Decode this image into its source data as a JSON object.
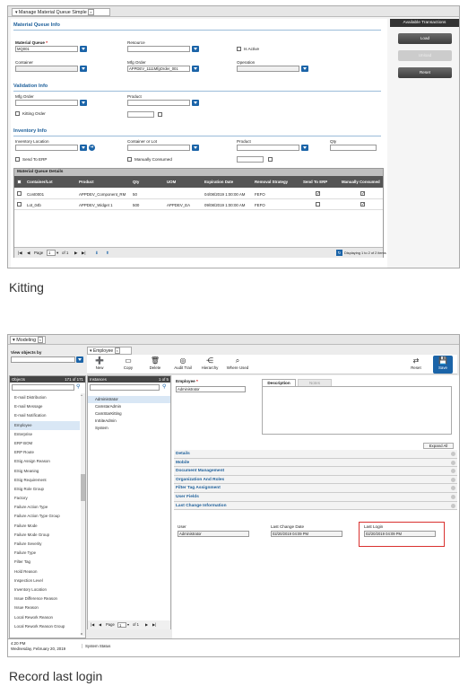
{
  "kitting": {
    "tab_title": "Manage Material Queue Simple",
    "sections": {
      "material_queue": "Material Queue Info",
      "validation": "Validation Info",
      "inventory": "Inventory Info"
    },
    "fields": {
      "material_queue_label": "Material Queue",
      "material_queue_value": "MQ001",
      "resource_label": "Resource",
      "is_active_label": "Is Active",
      "container_label": "Container",
      "mfg_order_label": "Mfg Order",
      "mfg_order_value": "APPDEV_1111MfgOrder_001",
      "operation_label": "Operation",
      "vmfg_order_label": "Mfg Order",
      "product_label": "Product",
      "kitting_order_label": "Kitting Order",
      "inventory_location_label": "Inventory Location",
      "container_or_lot_label": "Container or Lot",
      "inv_product_label": "Product",
      "qty_label": "Qty",
      "send_to_erp_label": "Send To ERP",
      "manually_consumed_label": "Manually Consumed"
    },
    "grid": {
      "title": "Material Queue Details",
      "columns": [
        "Container/Lot",
        "Product",
        "Qty",
        "UOM",
        "Expiration Date",
        "Removal Strategy",
        "Send To ERP",
        "Manually Consumed"
      ],
      "rows": [
        {
          "lot": "Cont0001",
          "product": "APPDEV_Component_RM",
          "qty": "50",
          "uom": "",
          "exp": "04/08/2019 1:00:00 AM",
          "strategy": "FEFO",
          "erp": false,
          "manual": true
        },
        {
          "lot": "Lot_04b",
          "product": "APPDEV_Widget 1",
          "qty": "500",
          "uom": "APPDEV_EA",
          "exp": "09/08/2019 1:00:00 AM",
          "strategy": "FEFO",
          "erp": false,
          "manual": true
        }
      ],
      "page_label": "Page",
      "page_value": "1",
      "of_label": "of 1",
      "displaying": "Displaying 1 to 2 of 2 items"
    },
    "transactions": {
      "title": "Available Transactions",
      "load": "Load",
      "unload": "Unload",
      "reset": "Reset"
    }
  },
  "caption1": "Kitting",
  "modeling": {
    "tab_title": "Modeling",
    "view_objects_by": "View objects by",
    "employee_tab": "Employee",
    "toolbar": [
      "New",
      "Copy",
      "Delete",
      "Audit Trail",
      "Hierarchy",
      "Where Used"
    ],
    "reset": "Reset",
    "save": "Save",
    "objects_header": "Objects",
    "objects_count": "171 of 171",
    "instances_header": "Instances",
    "instances_count": "1 of 5",
    "objects": [
      "E-mail Distribution",
      "E-mail Message",
      "E-mail Notification",
      "Employee",
      "Enterprise",
      "ERP BOM",
      "ERP Route",
      "ESig Assign Reason",
      "ESig Meaning",
      "ESig Requirement",
      "ESig Role Group",
      "Factory",
      "Failure Action Type",
      "Failure Action Type Group",
      "Failure Mode",
      "Failure Mode Group",
      "Failure Severity",
      "Failure Type",
      "Filter Tag",
      "Hold Reason",
      "Inspection Level",
      "Inventory Location",
      "Issue Difference Reason",
      "Issue Reason",
      "Local Rework Reason",
      "Local Rework Reason Group"
    ],
    "instances": [
      "Administrator",
      "CamstarAdmin",
      "CamStarKitting",
      "InSiteAdmin",
      "System"
    ],
    "employee_label": "Employee",
    "employee_value": "Administrator",
    "desc_tab": "Description",
    "notes_tab": "Notes",
    "expand_all": "Expand All",
    "accordion": [
      "Details",
      "Mobile",
      "Document Management",
      "Organization And Roles",
      "Filter Tag Assignment",
      "User Fields",
      "Last Change Information"
    ],
    "last_change": {
      "user_label": "User",
      "user_value": "Administrator",
      "date_label": "Last Change Date",
      "date_value": "02/20/2019 04:09 PM",
      "login_label": "Last Login",
      "login_value": "02/20/2019 04:09 PM"
    },
    "page_label": "Page",
    "page_value": "1",
    "of_label": "of 1",
    "clock": "4:20 PM",
    "date": "Wednesday, February 20, 2019",
    "system_status": "System Status"
  },
  "caption2": "Record last login",
  "colors": {
    "accent": "#1b64a8",
    "highlight": "#d9312f"
  }
}
